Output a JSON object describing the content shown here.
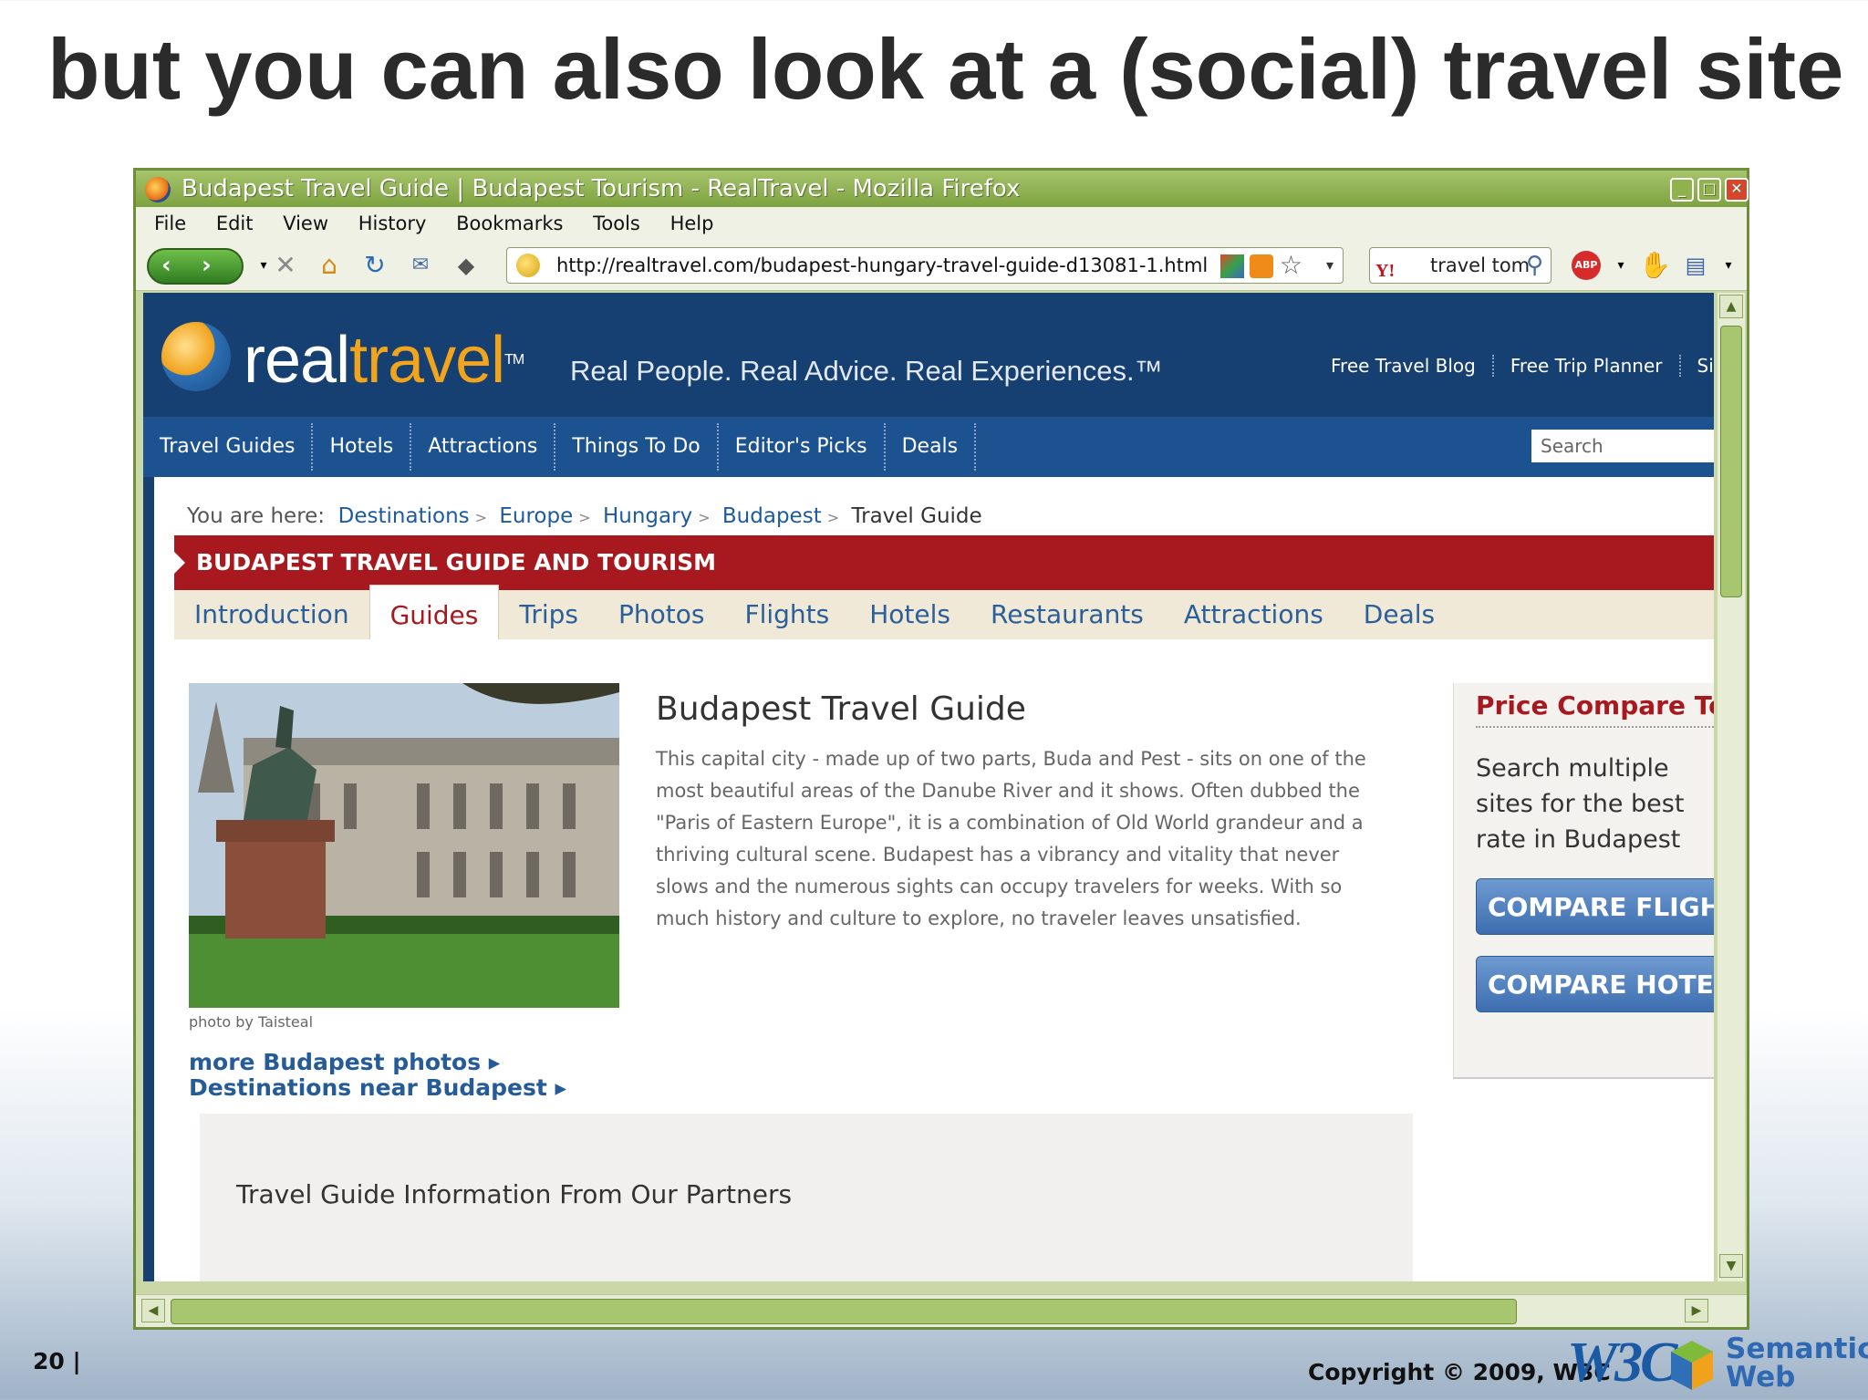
{
  "slide": {
    "title": "but you can also look at a (social) travel site",
    "page_number": "20 |",
    "copyright": "Copyright © 2009, W3C",
    "w3c_logo": "W3C",
    "semantic_web_logo": "Semantic Web"
  },
  "browser": {
    "title": "Budapest Travel Guide | Budapest Tourism - RealTravel - Mozilla Firefox",
    "menu": [
      "File",
      "Edit",
      "View",
      "History",
      "Bookmarks",
      "Tools",
      "Help"
    ],
    "url": "http://realtravel.com/budapest-hungary-travel-guide-d13081-1.html",
    "search_value": "travel tom",
    "abp_label": "ABP",
    "yahoo_label": "Y!",
    "icons": [
      "back-icon",
      "forward-icon",
      "stop-icon",
      "home-icon",
      "reload-icon",
      "rss-icon",
      "bookmark-star-icon",
      "search-magnifier-icon"
    ]
  },
  "site": {
    "logo_real": "real",
    "logo_travel": "travel",
    "logo_tm": "TM",
    "tagline": "Real People. Real Advice. Real Experiences.™",
    "header_links": [
      "Free Travel Blog",
      "Free Trip Planner",
      "Sign"
    ],
    "nav": [
      "Travel Guides",
      "Hotels",
      "Attractions",
      "Things To Do",
      "Editor's Picks",
      "Deals"
    ],
    "search_placeholder": "Search",
    "breadcrumb_label": "You are here:",
    "breadcrumb": [
      "Destinations",
      "Europe",
      "Hungary",
      "Budapest"
    ],
    "breadcrumb_current": "Travel Guide",
    "banner": "BUDAPEST TRAVEL GUIDE AND TOURISM",
    "tabs": [
      "Introduction",
      "Guides",
      "Trips",
      "Photos",
      "Flights",
      "Hotels",
      "Restaurants",
      "Attractions",
      "Deals"
    ],
    "photo_credit": "photo by Taisteal",
    "more_photos": "more Budapest photos ▸",
    "destinations_near": "Destinations near Budapest ▸",
    "guide_title": "Budapest Travel Guide",
    "guide_text": "This capital city - made up of two parts, Buda and Pest - sits on one of the most beautiful areas of the Danube River and it shows. Often dubbed the \"Paris of Eastern Europe\", it is a combination of Old World grandeur and a thriving cultural scene. Budapest has a vibrancy and vitality that never slows and the numerous sights can occupy travelers for weeks. With so much history and culture to explore, no traveler leaves unsatisfied.",
    "price_tool_title": "Price Compare Tool",
    "price_tool_text": "Search multiple sites for the best rate in Budapest",
    "compare_flights": "COMPARE FLIGHTS",
    "compare_hotels": "COMPARE HOTELS",
    "partners_title": "Travel Guide Information From Our Partners"
  },
  "colors": {
    "header_blue": "#163f72",
    "nav_blue": "#1d5291",
    "banner_red": "#a8191f",
    "firefox_green": "#7ea23f"
  }
}
